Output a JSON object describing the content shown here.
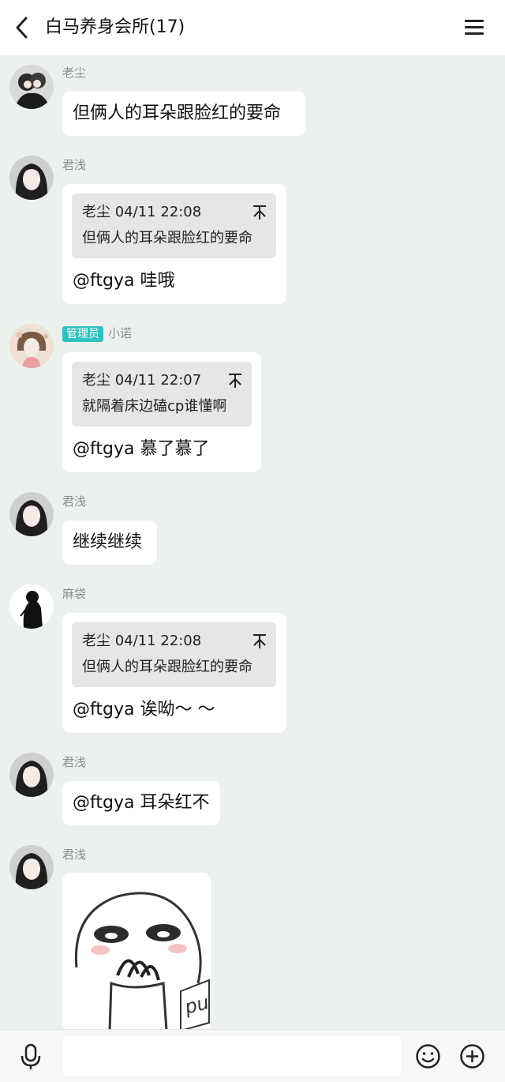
{
  "header": {
    "title": "白马养身会所(17)"
  },
  "messages": [
    {
      "sender": "老尘",
      "text": "但俩人的耳朵跟脸红的要命"
    },
    {
      "sender": "君浅",
      "quote": {
        "meta": "老尘 04/11 22:08",
        "text": "但俩人的耳朵跟脸红的要命"
      },
      "text": "@ftgya 哇哦"
    },
    {
      "badge": "管理员",
      "sender": "小诺",
      "quote": {
        "meta": "老尘 04/11 22:07",
        "text": "就隔着床边磕cp谁懂啊"
      },
      "text": "@ftgya 慕了慕了"
    },
    {
      "sender": "君浅",
      "text": "继续继续"
    },
    {
      "sender": "麻袋",
      "quote": {
        "meta": "老尘 04/11 22:08",
        "text": "但俩人的耳朵跟脸红的要命"
      },
      "text": "@ftgya 诶呦～ ～"
    },
    {
      "sender": "君浅",
      "text": "@ftgya 耳朵红不"
    },
    {
      "sender": "君浅",
      "sticker_text": "pu"
    }
  ],
  "footer": {
    "input_placeholder": ""
  },
  "colors": {
    "background": "#edf1ee",
    "bubble": "#ffffff",
    "quote": "#e6e6e6",
    "admin_badge": "#2fc3c0"
  }
}
